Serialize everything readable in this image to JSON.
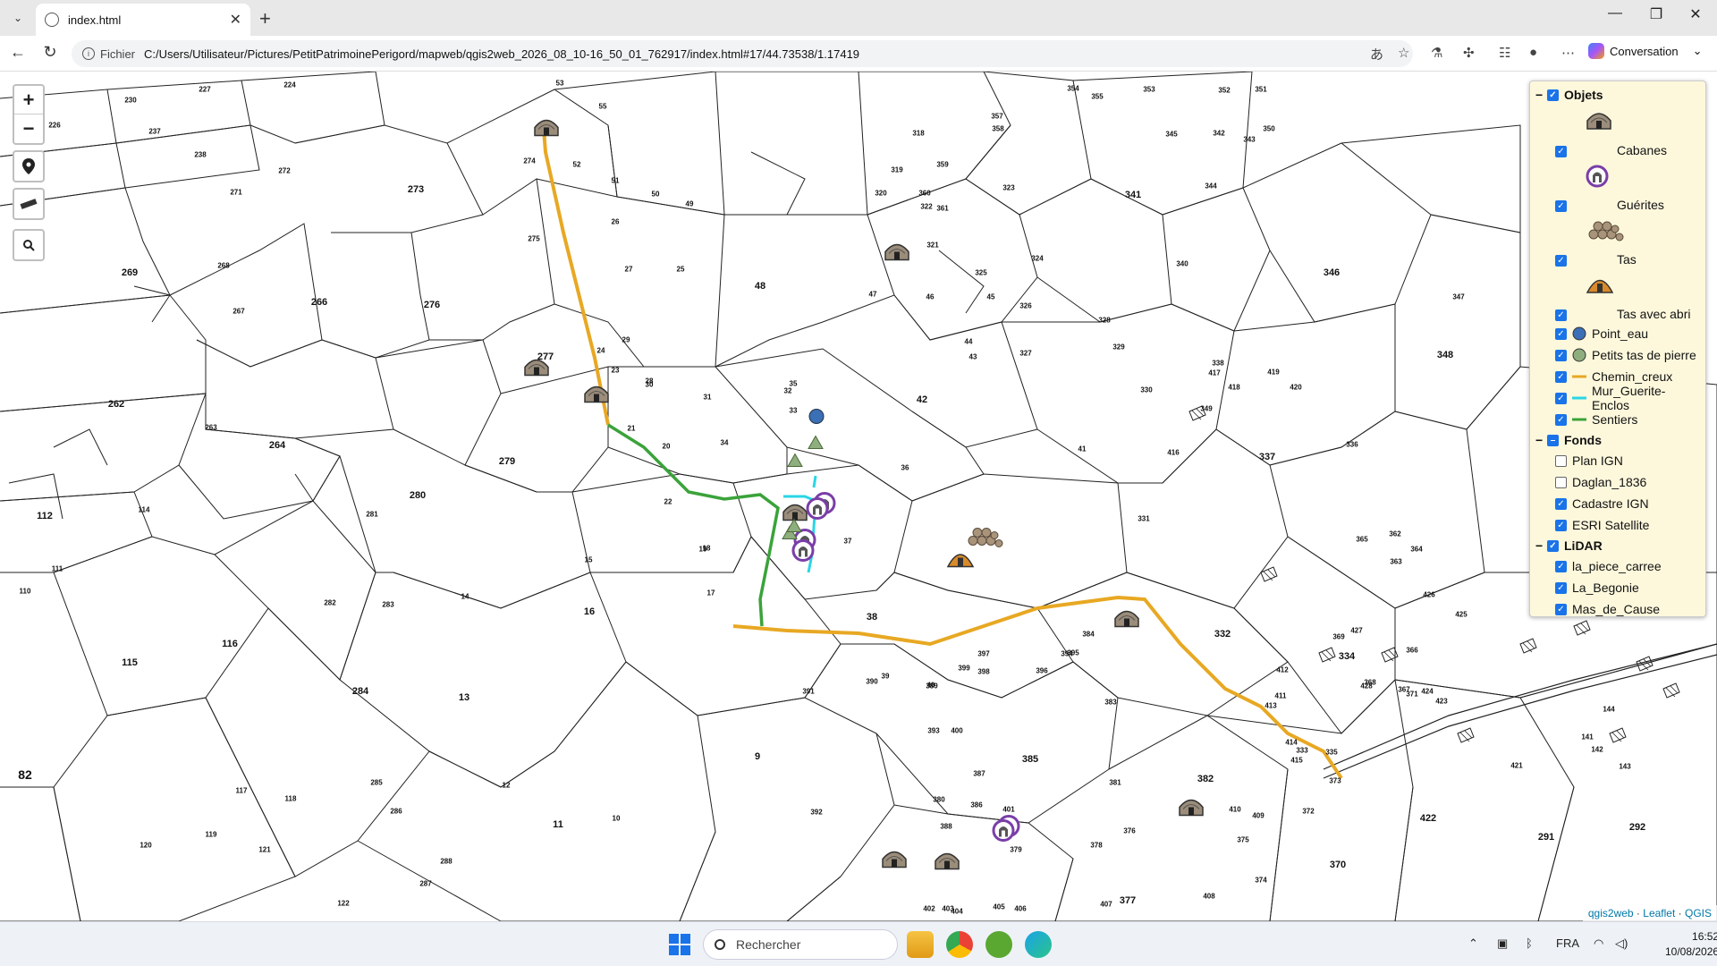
{
  "browser": {
    "tab_title": "index.html",
    "url_scheme": "Fichier",
    "url": "C:/Users/Utilisateur/Pictures/PetitPatrimoinePerigord/mapweb/qgis2web_2026_08_10-16_50_01_762917/index.html#17/44.73538/1.17419",
    "conversation_label": "Conversation"
  },
  "map": {
    "zoom_in": "+",
    "zoom_out": "−",
    "parcels": [
      {
        "t": "273",
        "big": true
      },
      {
        "t": "269",
        "big": true
      },
      {
        "t": "266",
        "big": true
      },
      {
        "t": "276",
        "big": true
      },
      {
        "t": "262",
        "big": true
      },
      {
        "t": "264",
        "big": true
      },
      {
        "t": "279",
        "big": true
      },
      {
        "t": "280",
        "big": true
      },
      {
        "t": "277",
        "big": true
      },
      {
        "t": "112",
        "big": true
      },
      {
        "t": "116",
        "big": true
      },
      {
        "t": "115",
        "big": true
      },
      {
        "t": "284",
        "big": true
      },
      {
        "t": "13",
        "big": true
      },
      {
        "t": "16",
        "big": true
      },
      {
        "t": "48",
        "big": true
      },
      {
        "t": "42",
        "big": true
      },
      {
        "t": "38",
        "big": true
      },
      {
        "t": "9",
        "big": true
      },
      {
        "t": "11",
        "big": true
      },
      {
        "t": "385",
        "big": true
      },
      {
        "t": "382",
        "big": true
      },
      {
        "t": "332",
        "big": true
      },
      {
        "t": "334",
        "big": true
      },
      {
        "t": "337",
        "big": true
      },
      {
        "t": "341",
        "big": true
      },
      {
        "t": "346",
        "big": true
      },
      {
        "t": "348",
        "big": true
      },
      {
        "t": "422",
        "big": true
      },
      {
        "t": "370",
        "big": true
      },
      {
        "t": "377",
        "big": true
      },
      {
        "t": "291",
        "big": true
      },
      {
        "t": "292",
        "big": true
      },
      {
        "t": "82",
        "xl": true
      },
      {
        "t": "227"
      },
      {
        "t": "224"
      },
      {
        "t": "230"
      },
      {
        "t": "226"
      },
      {
        "t": "237"
      },
      {
        "t": "238"
      },
      {
        "t": "272"
      },
      {
        "t": "271"
      },
      {
        "t": "274"
      },
      {
        "t": "275"
      },
      {
        "t": "267"
      },
      {
        "t": "268"
      },
      {
        "t": "263"
      },
      {
        "t": "281"
      },
      {
        "t": "282"
      },
      {
        "t": "283"
      },
      {
        "t": "114"
      },
      {
        "t": "111"
      },
      {
        "t": "110"
      },
      {
        "t": "117"
      },
      {
        "t": "118"
      },
      {
        "t": "119"
      },
      {
        "t": "120"
      },
      {
        "t": "121"
      },
      {
        "t": "122"
      },
      {
        "t": "285"
      },
      {
        "t": "286"
      },
      {
        "t": "287"
      },
      {
        "t": "288"
      },
      {
        "t": "14"
      },
      {
        "t": "12"
      },
      {
        "t": "10"
      },
      {
        "t": "53"
      },
      {
        "t": "55"
      },
      {
        "t": "52"
      },
      {
        "t": "51"
      },
      {
        "t": "50"
      },
      {
        "t": "49"
      },
      {
        "t": "47"
      },
      {
        "t": "46"
      },
      {
        "t": "45"
      },
      {
        "t": "43"
      },
      {
        "t": "44"
      },
      {
        "t": "39"
      },
      {
        "t": "40"
      },
      {
        "t": "41"
      },
      {
        "t": "36"
      },
      {
        "t": "37"
      },
      {
        "t": "35"
      },
      {
        "t": "34"
      },
      {
        "t": "33"
      },
      {
        "t": "32"
      },
      {
        "t": "31"
      },
      {
        "t": "30"
      },
      {
        "t": "29"
      },
      {
        "t": "28"
      },
      {
        "t": "27"
      },
      {
        "t": "26"
      },
      {
        "t": "25"
      },
      {
        "t": "24"
      },
      {
        "t": "23"
      },
      {
        "t": "22"
      },
      {
        "t": "21"
      },
      {
        "t": "20"
      },
      {
        "t": "19"
      },
      {
        "t": "18"
      },
      {
        "t": "17"
      },
      {
        "t": "15"
      },
      {
        "t": "318"
      },
      {
        "t": "319"
      },
      {
        "t": "320"
      },
      {
        "t": "321"
      },
      {
        "t": "322"
      },
      {
        "t": "323"
      },
      {
        "t": "324"
      },
      {
        "t": "325"
      },
      {
        "t": "326"
      },
      {
        "t": "327"
      },
      {
        "t": "328"
      },
      {
        "t": "329"
      },
      {
        "t": "330"
      },
      {
        "t": "331"
      },
      {
        "t": "333"
      },
      {
        "t": "335"
      },
      {
        "t": "336"
      },
      {
        "t": "338"
      },
      {
        "t": "340"
      },
      {
        "t": "342"
      },
      {
        "t": "343"
      },
      {
        "t": "344"
      },
      {
        "t": "345"
      },
      {
        "t": "347"
      },
      {
        "t": "349"
      },
      {
        "t": "350"
      },
      {
        "t": "351"
      },
      {
        "t": "352"
      },
      {
        "t": "353"
      },
      {
        "t": "354"
      },
      {
        "t": "355"
      },
      {
        "t": "357"
      },
      {
        "t": "358"
      },
      {
        "t": "359"
      },
      {
        "t": "360"
      },
      {
        "t": "361"
      },
      {
        "t": "362"
      },
      {
        "t": "363"
      },
      {
        "t": "364"
      },
      {
        "t": "365"
      },
      {
        "t": "366"
      },
      {
        "t": "367"
      },
      {
        "t": "368"
      },
      {
        "t": "369"
      },
      {
        "t": "371"
      },
      {
        "t": "372"
      },
      {
        "t": "373"
      },
      {
        "t": "374"
      },
      {
        "t": "375"
      },
      {
        "t": "376"
      },
      {
        "t": "378"
      },
      {
        "t": "379"
      },
      {
        "t": "380"
      },
      {
        "t": "381"
      },
      {
        "t": "383"
      },
      {
        "t": "384"
      },
      {
        "t": "386"
      },
      {
        "t": "387"
      },
      {
        "t": "388"
      },
      {
        "t": "389"
      },
      {
        "t": "390"
      },
      {
        "t": "391"
      },
      {
        "t": "392"
      },
      {
        "t": "393"
      },
      {
        "t": "394"
      },
      {
        "t": "395"
      },
      {
        "t": "396"
      },
      {
        "t": "397"
      },
      {
        "t": "398"
      },
      {
        "t": "399"
      },
      {
        "t": "400"
      },
      {
        "t": "401"
      },
      {
        "t": "402"
      },
      {
        "t": "403"
      },
      {
        "t": "404"
      },
      {
        "t": "405"
      },
      {
        "t": "406"
      },
      {
        "t": "407"
      },
      {
        "t": "408"
      },
      {
        "t": "409"
      },
      {
        "t": "410"
      },
      {
        "t": "411"
      },
      {
        "t": "412"
      },
      {
        "t": "413"
      },
      {
        "t": "414"
      },
      {
        "t": "415"
      },
      {
        "t": "416"
      },
      {
        "t": "417"
      },
      {
        "t": "418"
      },
      {
        "t": "419"
      },
      {
        "t": "420"
      },
      {
        "t": "421"
      },
      {
        "t": "423"
      },
      {
        "t": "424"
      },
      {
        "t": "425"
      },
      {
        "t": "426"
      },
      {
        "t": "427"
      },
      {
        "t": "428"
      },
      {
        "t": "141"
      },
      {
        "t": "142"
      },
      {
        "t": "143"
      },
      {
        "t": "144"
      }
    ],
    "attribution": {
      "a": "qgis2web",
      "b": "Leaflet",
      "c": "QGIS"
    }
  },
  "layers": {
    "groups": [
      {
        "name": "Objets",
        "checked": true,
        "items": [
          {
            "label": "Cabanes",
            "checked": true,
            "icon": "cabane-icon",
            "tall": true
          },
          {
            "label": "Guérites",
            "checked": true,
            "icon": "guerite-icon",
            "tall": true
          },
          {
            "label": "Tas",
            "checked": true,
            "icon": "tas-icon",
            "tall": true
          },
          {
            "label": "Tas avec abri",
            "checked": true,
            "icon": "tas-abri-icon",
            "tall": true
          },
          {
            "label": "Point_eau",
            "checked": true,
            "icon": "point-eau-icon",
            "color": "#3b6fb6"
          },
          {
            "label": "Petits tas de pierre",
            "checked": true,
            "icon": "petit-tas-icon",
            "color": "#8fae7e"
          },
          {
            "label": "Chemin_creux",
            "checked": true,
            "icon": "line-icon",
            "color": "#e8a823"
          },
          {
            "label": "Mur_Guerite-Enclos",
            "checked": true,
            "icon": "line-icon",
            "color": "#29d6e6"
          },
          {
            "label": "Sentiers",
            "checked": true,
            "icon": "line-icon",
            "color": "#3aa33a"
          }
        ]
      },
      {
        "name": "Fonds",
        "checked": "partial",
        "items": [
          {
            "label": "Plan IGN",
            "checked": false
          },
          {
            "label": "Daglan_1836",
            "checked": false
          },
          {
            "label": "Cadastre IGN",
            "checked": true
          },
          {
            "label": "ESRI Satellite",
            "checked": true
          }
        ]
      },
      {
        "name": "LiDAR",
        "checked": true,
        "items": [
          {
            "label": "la_piece_carree",
            "checked": true
          },
          {
            "label": "La_Begonie",
            "checked": true
          },
          {
            "label": "Mas_de_Cause",
            "checked": true
          }
        ]
      }
    ]
  },
  "taskbar": {
    "search_placeholder": "Rechercher",
    "lang": "FRA",
    "time": "16:52",
    "date": "10/08/2026"
  }
}
